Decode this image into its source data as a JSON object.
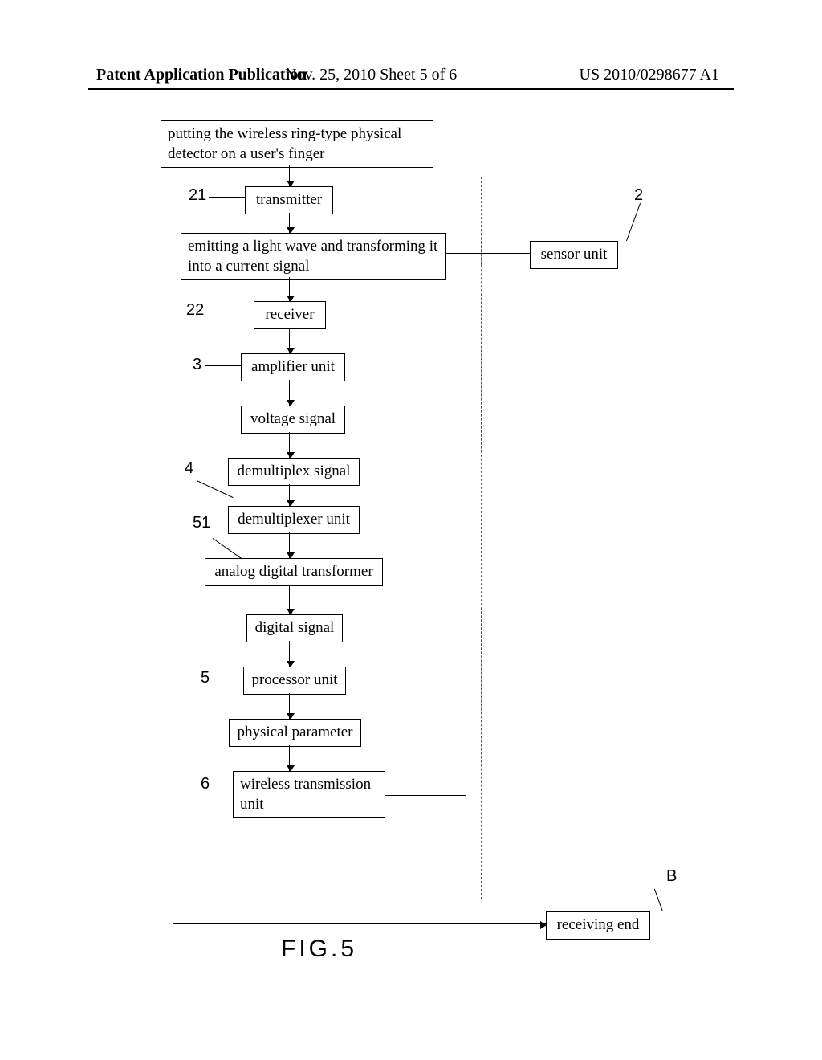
{
  "header": {
    "left": "Patent Application Publication",
    "mid": "Nov. 25, 2010  Sheet 5 of 6",
    "right": "US 2010/0298677 A1"
  },
  "figure_label": "FIG.5",
  "boxes": {
    "start": "putting the wireless ring-type physical detector on a user's finger",
    "transmitter": "transmitter",
    "emit": "emitting a light wave and transforming it into a current signal",
    "receiver": "receiver",
    "amplifier": "amplifier unit",
    "voltage": "voltage signal",
    "demux_signal": "demultiplex signal",
    "demux_unit": "demultiplexer unit",
    "adt": "analog digital transformer",
    "digital": "digital signal",
    "processor": "processor unit",
    "physical": "physical parameter",
    "wireless": "wireless transmission unit",
    "sensor": "sensor unit",
    "receiving": "receiving end"
  },
  "refs": {
    "r21": "21",
    "r22": "22",
    "r2": "2",
    "r3": "3",
    "r4": "4",
    "r51": "51",
    "r5": "5",
    "r6": "6",
    "rB": "B"
  }
}
